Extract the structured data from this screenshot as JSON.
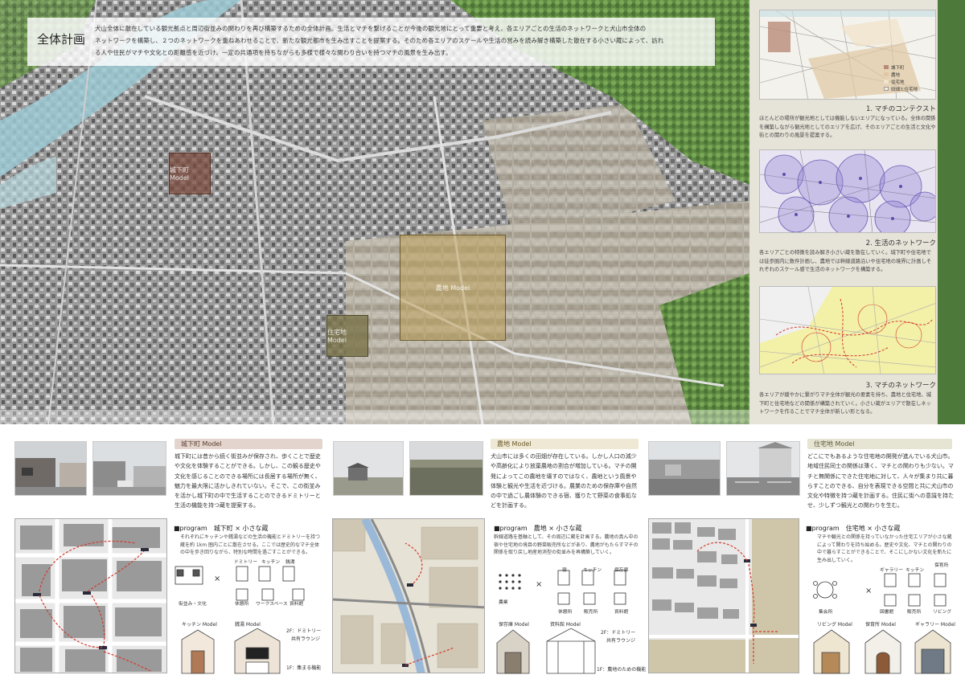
{
  "overview": {
    "title": "全体計画",
    "lines": [
      "犬山全体に散在している観光拠点と周辺街並みの関わりを再び構築するための全体計画。生活とマチを繋げることが今後の観光地にとって重要と考え、各エリアごとの生活のネットワークと犬山市全体の",
      "ネットワークを構築し、２つのネットワークを重ねあわせることで、新たな観光都市を生み出すことを提案する。そのため各エリアのスケールや生活の営みを読み解き構築した散在する小さい蔵によって、訪れ",
      "る人や住民がマチや文化との距離感を近づけ、一定の共通項を持ちながらも多様で様々な関わり合いを持つマチの風景を生み出す。"
    ]
  },
  "map_labels": {
    "castle": "城下町 Model",
    "farm": "農地 Model",
    "house": "住宅地 Model"
  },
  "context": {
    "legend": [
      "城下町",
      "農地",
      "住宅地",
      "田畑と住宅地"
    ],
    "caption": "1. マチのコンテクスト",
    "text": "ほとんどの場所が観光地としては機能しないエリアになっている。全体の関係を構築しながら観光地としてのエリアを広げ、そのエリアごとの生活と文化や街との関わりの風景を提案する。"
  },
  "life_network": {
    "caption": "2. 生活のネットワーク",
    "text": "各エリアごとの特徴を読み解き小さい蔵を散在していく。城下町や住宅地では徒歩圏内に数件計画し、農地では幹線道路沿いや住宅地の境界に計画しそれぞれのスケール感で生活のネットワークを構築する。"
  },
  "town_network": {
    "caption": "3. マチのネットワーク",
    "text": "各エリアが緩やかに繋がりマチ全体が観光の要素を持ち、農地と住宅地、城下町と住宅地などの関係が構築されていく。小さい蔵がエリアで散在しネットワークを作ることでマチ全体が新しい形となる。"
  },
  "castle": {
    "header": "城下町 Model",
    "text": "城下町には昔から続く街並みが保存され、歩くことで歴史や文化を体験することができる。しかし、この観る歴史や文化を感じることのできる場所には長居する場所が無く、魅力を最大限に活かしきれていない。そこで、この街並みを活かし城下町の中で生活することのできるドミトリーと生活の機能を持つ蔵を提案する。",
    "program_head": "■program　城下町 × 小さな蔵",
    "program_text": "それぞれにキッチンや銭湯などの生活の機能とドミトリーを持つ蔵を約 1km 圏内ごとに散在させる。ここでは歴史的なマチ全体の中を歩き回りながら、特別な時間を過ごすことができる。",
    "labels": [
      "街並み・文化",
      "ドミトリー",
      "キッチン",
      "銭湯",
      "休憩所",
      "ワークスペース",
      "資料館"
    ],
    "models": [
      "キッチン Model",
      "銭湯 Model"
    ],
    "notes": [
      "2F：ドミトリー",
      "共有ラウンジ",
      "1F：集まる機能"
    ]
  },
  "farm": {
    "header": "農地 Model",
    "text": "犬山市には多くの田畑が存在している。しかし人口の減少や高齢化により放棄農地の割合が増加している。マチの開発によってこの農地を壊すのではなく、農地という風景や体験と観光や生活を近づける。農業のための保存庫や自然の中で過ごし農体験のできる宿、獲りたて野菜の食事処などを計画する。",
    "program_head": "■program　農地 × 小さな蔵",
    "program_text": "幹線道路を基軸として、その周辺に蔵を計画する。農地の真ん中の宿や住宅地の境目の野菜販売所などがあり、農地がもたらすマチの関係を取り戻し地産地消型の街並みを再構築していく。",
    "labels": [
      "宿",
      "キッチン",
      "保存庫",
      "農業",
      "休憩所",
      "販売所",
      "資料館"
    ],
    "models": [
      "保存庫 Model",
      "資料館 Model"
    ],
    "notes": [
      "2F：ドミトリー",
      "共有ラウンジ",
      "1F：農地のための機能"
    ]
  },
  "house": {
    "header": "住宅地 Model",
    "text": "どこにでもあるような住宅地の開発が進んでいる犬山市。地域住民同士の関係は薄く、マチとの関わりも少ない。マチと無関係にできた住宅地に対して、人々が集まり共に暮らすことのできる、自分を表現できる空間と共に犬山市の文化や特徴を持つ蔵を計画する。住民に街への意識を持たせ、少しずつ観光との関わりを生む。",
    "program_head": "■program　住宅地 × 小さな蔵",
    "program_text": "マチや観光との関係を持っていなかった住宅エリアが小さな蔵によって関わりを持ち始める。歴史や文化、マチとの関わりの中で暮らすことができることで、そこにしかない文化を新たに生み出していく。",
    "labels": [
      "ギャラリー",
      "キッチン",
      "保育所",
      "図書館",
      "販売所",
      "リビング",
      "集会所"
    ],
    "models": [
      "リビング Model",
      "保育所 Model",
      "ギャラリー Model"
    ]
  },
  "colors": {
    "castle": "#7a4a3c",
    "farm": "#a58c52",
    "house": "#7a7348",
    "route": "#d43a2c",
    "header_bg": "#e3d5cd"
  }
}
